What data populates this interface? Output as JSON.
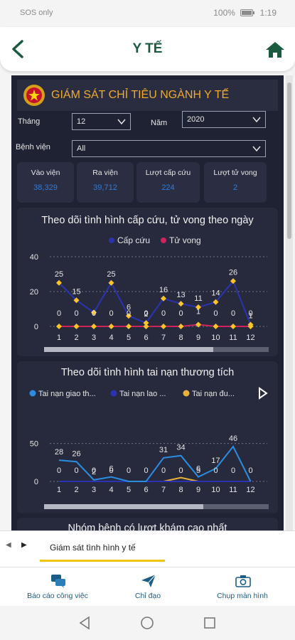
{
  "status": {
    "left": "SOS only",
    "battery": "100%",
    "time": "1:19"
  },
  "appbar": {
    "title": "Y TẾ",
    "back_icon": "back-chevron-icon",
    "home_icon": "home-icon"
  },
  "report": {
    "title": "GIÁM SÁT CHỈ TIÊU NGÀNH Y TẾ",
    "filters": {
      "month_label": "Tháng",
      "month_value": "12",
      "year_label": "Năm",
      "year_value": "2020",
      "hospital_label": "Bệnh viện",
      "hospital_value": "All"
    },
    "cards": [
      {
        "title": "Vào viện",
        "value": "38,329"
      },
      {
        "title": "Ra viện",
        "value": "39,712"
      },
      {
        "title": "Lượt cấp cứu",
        "value": "224"
      },
      {
        "title": "Lượt tử vong",
        "value": "2"
      }
    ],
    "chart1_title": "Theo dõi tình hình cấp cứu, tử vong theo ngày",
    "chart2_title": "Theo dõi tình hình tai nạn thương tích",
    "chart3_title_partial": "Nhóm bệnh có lượt khám cao nhất",
    "colors": {
      "accent": "#f1a92c",
      "navy_line": "#2c33b0",
      "blue_line": "#2a8de0",
      "orange_line": "#e9b33a",
      "crimson": "#d1235b",
      "diamond": "#ffc425"
    }
  },
  "chart_data": [
    {
      "type": "line",
      "title": "Theo dõi tình hình cấp cứu, tử vong theo ngày",
      "legend": "top-center",
      "categories": [
        "1",
        "2",
        "3",
        "4",
        "5",
        "6",
        "7",
        "8",
        "9",
        "10",
        "11",
        "12"
      ],
      "yticks": [
        "0",
        "20",
        "40"
      ],
      "ylim": [
        0,
        40
      ],
      "series": [
        {
          "name": "Cấp cứu",
          "color": "#2c33b0",
          "values": [
            25,
            15,
            8,
            25,
            6,
            2,
            16,
            13,
            11,
            14,
            26,
            1
          ]
        },
        {
          "name": "Tử vong",
          "color": "#d1235b",
          "values": [
            0,
            0,
            0,
            0,
            0,
            0,
            0,
            0,
            1,
            0,
            0,
            0
          ]
        }
      ],
      "top_labels": [
        "25",
        "15",
        "",
        "25",
        "6",
        "2",
        "16",
        "13",
        "11",
        "14",
        "26",
        "1"
      ],
      "bottom_labels": [
        "0",
        "0",
        "0",
        "0",
        "0",
        "0",
        "0",
        "0",
        "1",
        "0",
        "0",
        "0"
      ]
    },
    {
      "type": "line",
      "title": "Theo dõi tình hình tai nạn thương tích",
      "legend": "top-left",
      "legend_labels": [
        "Tai nạn giao th...",
        "Tai nạn lao ...",
        "Tai nạn đu..."
      ],
      "categories": [
        "1",
        "2",
        "3",
        "4",
        "5",
        "6",
        "7",
        "8",
        "9",
        "10",
        "11",
        "12"
      ],
      "yticks": [
        "0",
        "50"
      ],
      "ylim": [
        0,
        60
      ],
      "series": [
        {
          "name": "Tai nạn giao th...",
          "color": "#2a8de0",
          "values": [
            28,
            26,
            2,
            6,
            0,
            0,
            31,
            34,
            6,
            17,
            46,
            0
          ]
        },
        {
          "name": "Tai nạn lao ...",
          "color": "#2c33b0",
          "values": [
            0,
            0,
            0,
            0,
            0,
            0,
            0,
            0,
            0,
            0,
            0,
            0
          ]
        },
        {
          "name": "Tai nạn đu...",
          "color": "#e9b33a",
          "values": [
            0,
            0,
            0,
            0,
            0,
            0,
            0,
            5,
            0,
            0,
            0,
            0
          ]
        }
      ],
      "top_labels": [
        "28",
        "26",
        "2",
        "6",
        "",
        "",
        "31",
        "34",
        "6",
        "17",
        "46",
        ""
      ],
      "bottom_labels": [
        "0",
        "0",
        "0",
        "0",
        "0",
        "0",
        "0",
        "0",
        "5",
        "0",
        "0",
        "0"
      ]
    }
  ],
  "tabbar": {
    "tab_label": "Giám sát tình hình y tế"
  },
  "bottomnav": [
    {
      "label": "Báo cáo công việc",
      "icon": "chat-icon"
    },
    {
      "label": "Chỉ đạo",
      "icon": "send-icon"
    },
    {
      "label": "Chụp màn hình",
      "icon": "camera-icon"
    }
  ]
}
